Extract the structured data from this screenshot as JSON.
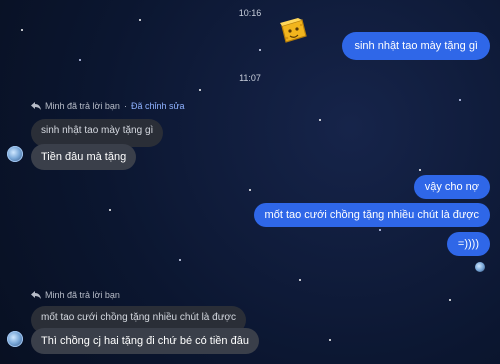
{
  "timestamps": {
    "first": "10:16",
    "second": "11:07"
  },
  "sticker": {
    "name": "cheese-sticker-icon"
  },
  "messages_out": {
    "m1": "sinh nhật tao mày tặng gì",
    "m2": "vậy cho nợ",
    "m3": "mốt tao cưới chồng tặng nhiều chút là được",
    "m4": "=))))"
  },
  "reply1": {
    "meta": "Minh đã trả lời bạn",
    "dot": "·",
    "edited": "Đã chỉnh sửa",
    "quoted": "sinh nhật tao mày tặng gì",
    "text": "Tiền đâu mà tặng"
  },
  "reply2": {
    "meta": "Minh đã trả lời bạn",
    "quoted": "mốt tao cưới chồng tặng nhiều chút là được",
    "text": "Thì chồng cj hai tặng đi chứ bé có tiền đâu"
  },
  "colors": {
    "outgoing": "#2f67e8",
    "incoming": "#3a3f4a",
    "quoted": "#2a2e37",
    "edited": "#8fb2ff"
  }
}
